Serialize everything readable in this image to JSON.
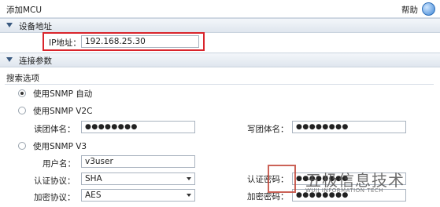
{
  "header": {
    "title": "添加MCU",
    "help_label": "帮助"
  },
  "sections": {
    "device_address": "设备地址",
    "connection_params": "连接参数"
  },
  "ip": {
    "label": "IP地址：",
    "value": "192.168.25.30"
  },
  "search": {
    "title": "搜索选项"
  },
  "options": {
    "snmp_auto": "使用SNMP 自动",
    "snmp_v2c": "使用SNMP V2C",
    "snmp_v3": "使用SNMP V3"
  },
  "v2c": {
    "read_label": "读团体名：",
    "read_value": "●●●●●●●●",
    "write_label": "写团体名：",
    "write_value": "●●●●●●●●"
  },
  "v3": {
    "user_label": "用户名：",
    "user_value": "v3user",
    "auth_proto_label": "认证协议：",
    "auth_proto_value": "SHA",
    "auth_pwd_label": "认证密码：",
    "auth_pwd_value": "●●●●●●●●",
    "enc_proto_label": "加密协议：",
    "enc_proto_value": "AES",
    "enc_pwd_label": "加密密码：",
    "enc_pwd_value": "●●●●●●●●"
  },
  "watermark": {
    "text": "五极信息技术",
    "sub": "WUJI INFORMATION TECH"
  }
}
